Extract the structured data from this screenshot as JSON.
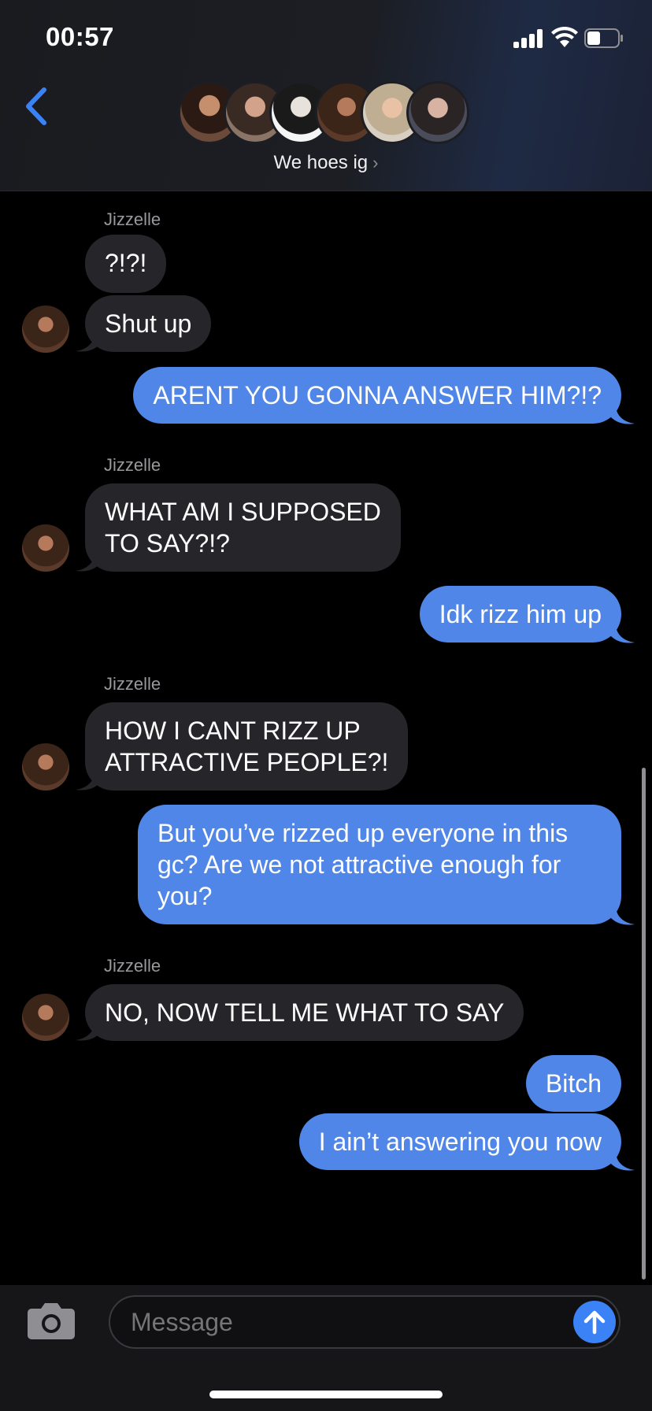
{
  "status_bar": {
    "time": "00:57"
  },
  "header": {
    "group_name": "We hoes ig",
    "chevron": "›",
    "participants": [
      {
        "icon": "avatar-1"
      },
      {
        "icon": "avatar-2"
      },
      {
        "icon": "avatar-3"
      },
      {
        "icon": "avatar-4"
      },
      {
        "icon": "avatar-5"
      },
      {
        "icon": "avatar-6"
      }
    ]
  },
  "messages": {
    "sender": "Jizzelle",
    "m1": "?!?!",
    "m2": "Shut up",
    "m3": "ARENT YOU GONNA ANSWER HIM?!?",
    "m4_line1": "WHAT AM I SUPPOSED",
    "m4_line2": "TO SAY?!?",
    "m5": "Idk rizz him up",
    "m6_line1": "HOW I CANT RIZZ UP",
    "m6_line2": "ATTRACTIVE PEOPLE?!",
    "m7_line1": "But you’ve rizzed up everyone in this",
    "m7_line2": "gc? Are we not attractive enough for",
    "m7_line3": "you?",
    "m8": "NO, NOW TELL ME WHAT TO SAY",
    "m9": "Bitch",
    "m10": "I ain’t answering you now"
  },
  "input": {
    "placeholder": "Message"
  },
  "colors": {
    "outgoing": "#4f86e8",
    "incoming": "#26262a",
    "accent": "#3b82f6"
  }
}
